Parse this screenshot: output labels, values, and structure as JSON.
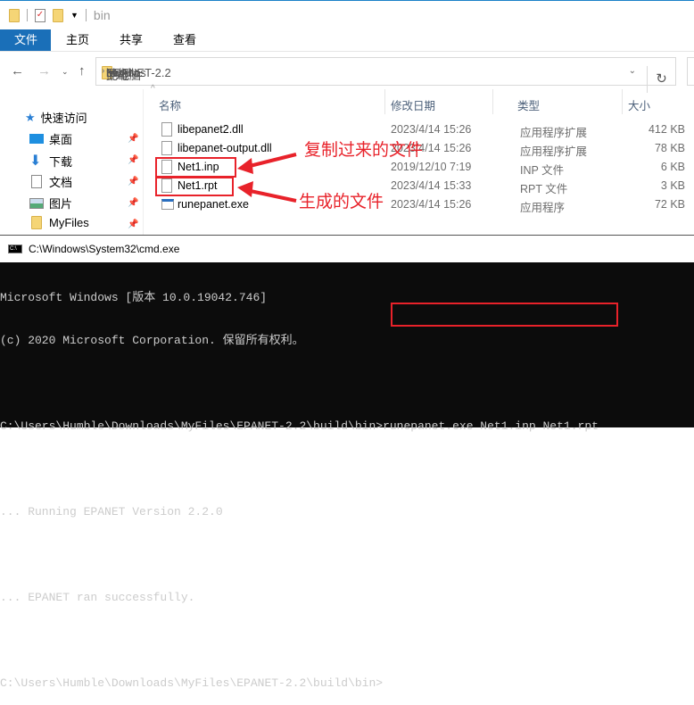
{
  "window": {
    "title": "bin"
  },
  "ribbon": {
    "tabs": [
      "文件",
      "主页",
      "共享",
      "查看"
    ]
  },
  "address": {
    "crumbs": [
      "此电脑",
      "下载",
      "MyFiles",
      "EPANET-2.2",
      "build",
      "bin"
    ]
  },
  "sidebar": {
    "quick_access": "快速访问",
    "items": [
      "桌面",
      "下载",
      "文档",
      "图片",
      "MyFiles"
    ]
  },
  "columns": {
    "name": "名称",
    "date": "修改日期",
    "type": "类型",
    "size": "大小"
  },
  "files": [
    {
      "name": "libepanet2.dll",
      "date": "2023/4/14 15:26",
      "type": "应用程序扩展",
      "size": "412 KB"
    },
    {
      "name": "libepanet-output.dll",
      "date": "2023/4/14 15:26",
      "type": "应用程序扩展",
      "size": "78 KB"
    },
    {
      "name": "Net1.inp",
      "date": "2019/12/10 7:19",
      "type": "INP 文件",
      "size": "6 KB"
    },
    {
      "name": "Net1.rpt",
      "date": "2023/4/14 15:33",
      "type": "RPT 文件",
      "size": "3 KB"
    },
    {
      "name": "runepanet.exe",
      "date": "2023/4/14 15:26",
      "type": "应用程序",
      "size": "72 KB"
    }
  ],
  "annotations": {
    "copied": "复制过来的文件",
    "generated": "生成的文件"
  },
  "cmd": {
    "title": "C:\\Windows\\System32\\cmd.exe",
    "lines": [
      "Microsoft Windows [版本 10.0.19042.746]",
      "(c) 2020 Microsoft Corporation. 保留所有权利。",
      "",
      "C:\\Users\\Humble\\Downloads\\MyFiles\\EPANET-2.2\\build\\bin>",
      "",
      "... Running EPANET Version 2.2.0",
      "",
      "... EPANET ran successfully.",
      "",
      "C:\\Users\\Humble\\Downloads\\MyFiles\\EPANET-2.2\\build\\bin>"
    ],
    "command": "runepanet.exe Net1.inp Net1.rpt"
  }
}
